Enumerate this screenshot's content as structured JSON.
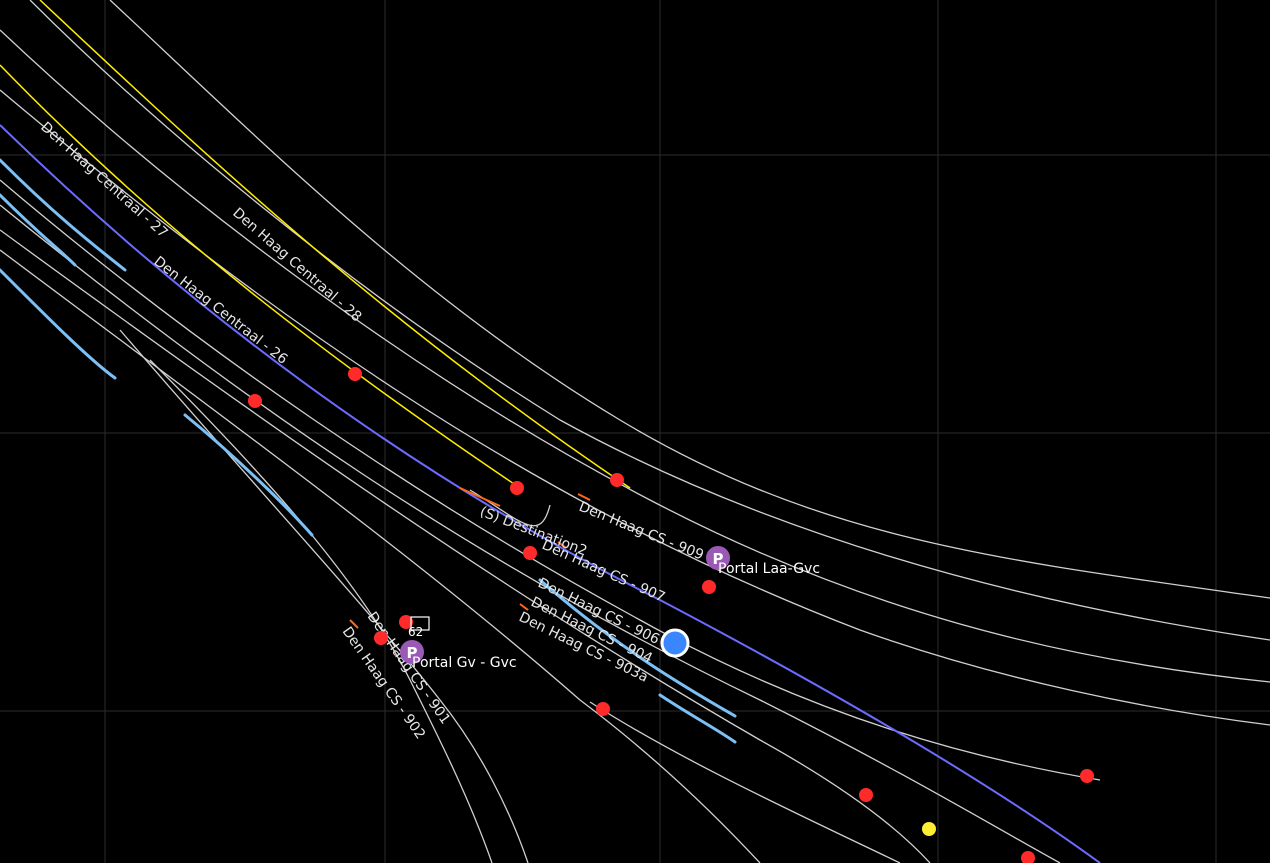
{
  "map": {
    "colors": {
      "background": "#000000",
      "grid": "#2b2b2b",
      "track": "#d0d0d0",
      "track_yellow": "#ffee00",
      "track_blue": "#6b6bff",
      "track_cyan": "#7cc0f5",
      "track_orange": "#ff6a1a",
      "signal_red": "#ff2a2a",
      "signal_yellow": "#ffee33",
      "portal": "#9b59b6",
      "position_marker": "#3a86ff"
    },
    "track_labels": [
      "Den Haag Centraal - 27",
      "Den Haag Centraal - 28",
      "Den Haag Centraal - 26",
      "(S) Destination2",
      "Den Haag CS - 909",
      "Den Haag CS - 907",
      "Den Haag CS - 906",
      "Den Haag CS - 904",
      "Den Haag CS - 903a",
      "Den Haag CS - 901",
      "Den Haag CS - 902"
    ],
    "portals": [
      {
        "icon": "parking-p-icon",
        "glyph": "P",
        "label": "Portal Laa-Gvc"
      },
      {
        "icon": "parking-p-icon",
        "glyph": "P",
        "label": "Portal Gv - Gvc"
      }
    ],
    "small_label": "62",
    "position_marker_icon": "current-position-icon",
    "signal_icon": "signal-icon"
  }
}
